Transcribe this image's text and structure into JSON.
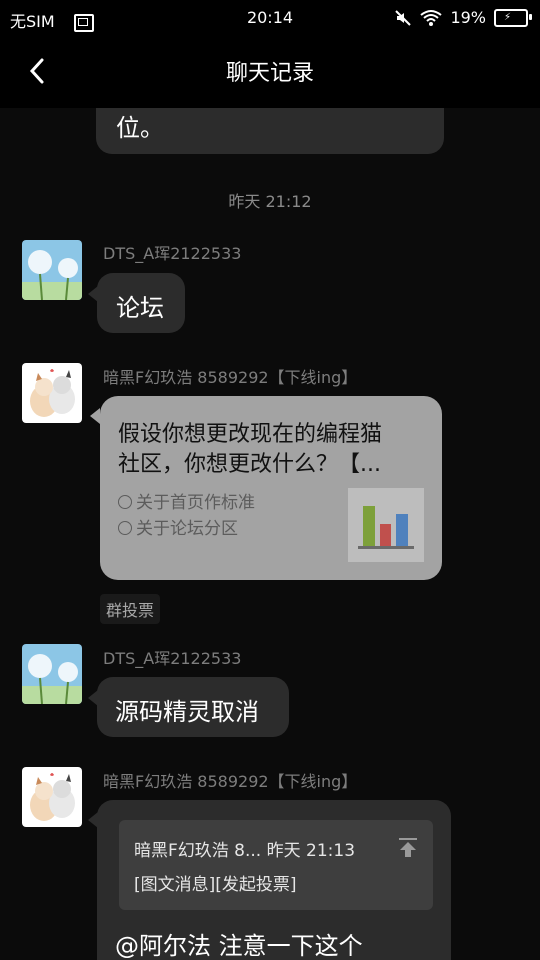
{
  "status": {
    "carrier": "无SIM",
    "time": "20:14",
    "battery": "19%"
  },
  "nav": {
    "title": "聊天记录",
    "back_icon": "chevron-left-icon"
  },
  "messages": {
    "partial_text": "位。",
    "timestamp": "昨天 21:12",
    "m1": {
      "sender": "DTS_A珲2122533",
      "text": "论坛"
    },
    "m2": {
      "sender": "暗黑F幻玖浩 8589292【下线ing】",
      "poll_title_line1": "假设你想更改现在的编程猫",
      "poll_title_line2": "社区，你想更改什么？【...",
      "option1": "关于首页作标准",
      "option2": "关于论坛分区",
      "tag": "群投票"
    },
    "m3": {
      "sender": "DTS_A珲2122533",
      "text": "源码精灵取消"
    },
    "m4": {
      "sender": "暗黑F幻玖浩 8589292【下线ing】",
      "quote_header": "暗黑F幻玖浩 8... 昨天 21:13",
      "quote_body": "[图文消息][发起投票]",
      "text": "@阿尔法 注意一下这个"
    }
  },
  "colors": {
    "background": "#0b0b0b",
    "bubble": "#2c2c2c",
    "poll_bubble": "#a3a3a3"
  }
}
